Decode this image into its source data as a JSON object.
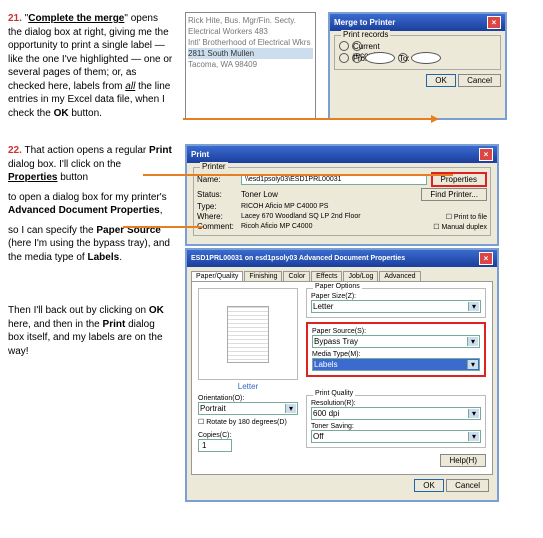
{
  "step21": {
    "num": "21.",
    "p1a": "  \"",
    "p1b": "Complete the merge",
    "p1c": "\" opens the dialog box at right, giving me the opportunity to print a single label — like the one I've highlighted — one or several pages of them; or, as checked here, labels from ",
    "p1d": "all",
    "p1e": " the line entries in my Excel data file, when I check the ",
    "p1f": "OK",
    "p1g": " button."
  },
  "list": {
    "r1": "Rick Hite, Bus. Mgr/Fin. Secty.",
    "r2": "Electrical Workers 483",
    "r3": "Intl' Brotherhood of Electrical Wkrs",
    "r4": "2811 South Mullen",
    "r5": "Tacoma, WA 98409"
  },
  "merge": {
    "title": "Merge to Printer",
    "legend": "Print records",
    "opt_current": "Current record",
    "opt_from": "From:",
    "to": "To:",
    "ok": "OK",
    "cancel": "Cancel"
  },
  "step22": {
    "num": "22.",
    "p1": "  That action opens a regular ",
    "p2": "Print",
    "p3": " dialog box.  I'll click on the ",
    "p4": "Properties",
    "p5": " button",
    "p6": "to open a dialog box for my printer's ",
    "p7": "Advanced Document Properties",
    "p8": ",",
    "p9": "so I can specify the ",
    "p10": "Paper Source",
    "p11": " (here I'm using the bypass tray), and the media type of ",
    "p12": "Labels",
    "p13": "."
  },
  "then": {
    "p1": "Then I'll back out by clicking on ",
    "p2": "OK",
    "p3": " here, and then in the ",
    "p4": "Print",
    "p5": " dialog box itself, and my labels are on the way!"
  },
  "print": {
    "title": "Print",
    "printer": "Printer",
    "name": "Name:",
    "namev": "\\\\esd1psoly03\\ESD1PRL00031",
    "status": "Status:",
    "statusv": "Toner Low",
    "type": "Type:",
    "typev": "RICOH Aficio MP C4000 PS",
    "where": "Where:",
    "wherev": "Lacey 670 Woodland SQ LP 2nd Floor",
    "comment": "Comment:",
    "commentv": "Ricoh Aficio MP C4000",
    "properties": "Properties",
    "find": "Find Printer...",
    "tofile": "Print to file",
    "manual": "Manual duplex"
  },
  "adv": {
    "title": "ESD1PRL00031 on esd1psoly03 Advanced Document Properties",
    "tabs": [
      "Paper/Quality",
      "Finishing",
      "Color",
      "Effects",
      "Job/Log",
      "Advanced"
    ],
    "paperopt": "Paper Options",
    "papersize": "Paper Size(Z):",
    "papersizev": "Letter",
    "papersrc": "Paper Source(S):",
    "papersrcv": "Bypass Tray",
    "mediatype": "Media Type(M):",
    "mediatypev": "Labels",
    "letter": "Letter",
    "orient": "Orientation(O):",
    "orientv": "Portrait",
    "rotate": "Rotate by 180 degrees(D)",
    "copies": "Copies(C):",
    "copiesv": "1",
    "quality": "Print Quality",
    "res": "Resolution(R):",
    "resv": "600 dpi",
    "toner": "Toner Saving:",
    "tonerv": "Off",
    "help": "Help(H)",
    "ok": "OK",
    "cancel": "Cancel"
  }
}
